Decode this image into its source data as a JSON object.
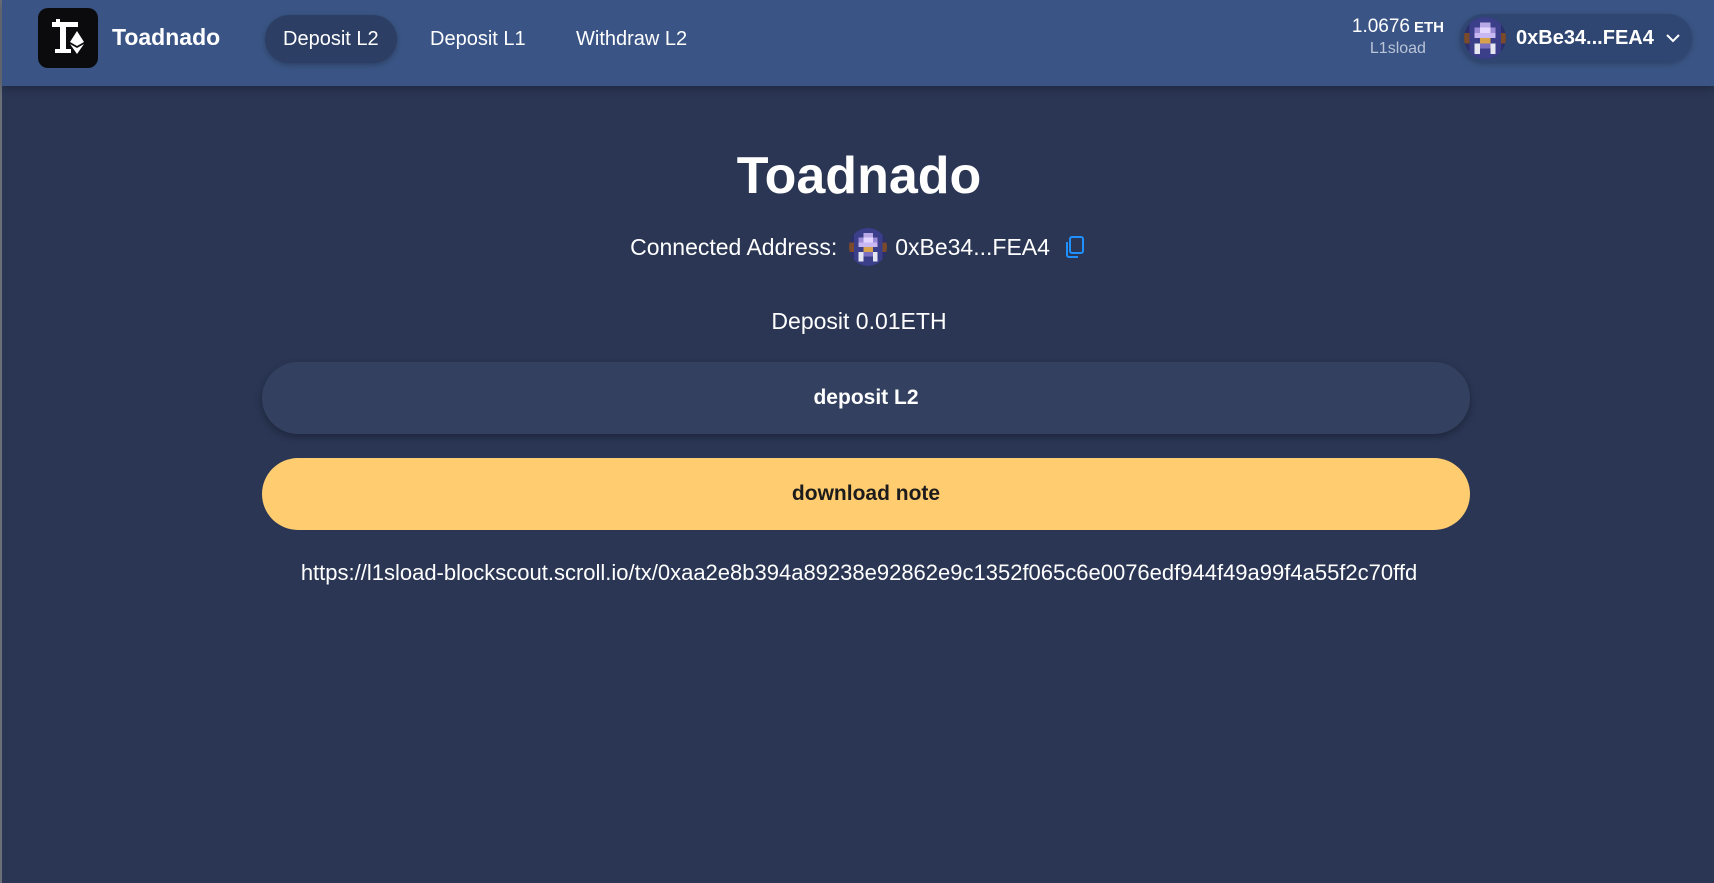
{
  "header": {
    "brand": "Toadnado",
    "tabs": [
      {
        "label": "Deposit L2",
        "active": true
      },
      {
        "label": "Deposit L1",
        "active": false
      },
      {
        "label": "Withdraw L2",
        "active": false
      }
    ],
    "balance": {
      "amount": "1.0676",
      "unit": "ETH",
      "network": "L1sload"
    },
    "account": {
      "address": "0xBe34...FEA4"
    }
  },
  "main": {
    "title": "Toadnado",
    "connected_label": "Connected Address:",
    "connected_address": "0xBe34...FEA4",
    "deposit_text": "Deposit 0.01ETH",
    "deposit_button": "deposit L2",
    "download_button": "download note",
    "tx_link": "https://l1sload-blockscout.scroll.io/tx/0xaa2e8b394a89238e92862e9c1352f065c6e0076edf944f49a99f4a55f2c70ffd"
  },
  "colors": {
    "background": "#2a3654",
    "navbar": "#3a5585",
    "download_button": "#ffcc70",
    "copy_icon": "#1e90ff"
  },
  "icons": {
    "logo": "toad-eth-logo-icon",
    "avatar": "pixel-avatar-icon",
    "chevron": "chevron-down-icon",
    "copy": "copy-icon"
  }
}
